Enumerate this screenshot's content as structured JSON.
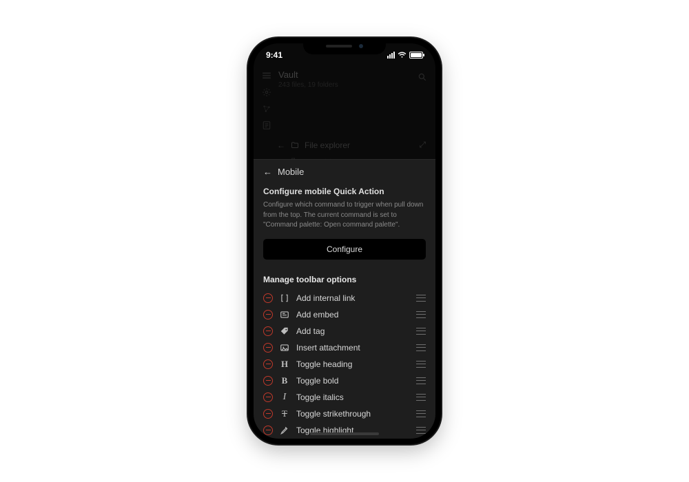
{
  "statusbar": {
    "time": "9:41"
  },
  "background": {
    "vault_title": "Vault",
    "vault_sub": "243 files, 19 folders",
    "nav_label": "File explorer"
  },
  "sheet": {
    "breadcrumb": "Mobile",
    "section_title": "Configure mobile Quick Action",
    "section_desc": "Configure which command to trigger when pull down from the top. The current command is set to \"Command palette: Open command palette\".",
    "configure_label": "Configure",
    "list_heading": "Manage toolbar options",
    "options": [
      {
        "icon": "brackets",
        "label": "Add internal link"
      },
      {
        "icon": "embed",
        "label": "Add embed"
      },
      {
        "icon": "tag",
        "label": "Add tag"
      },
      {
        "icon": "image",
        "label": "Insert attachment"
      },
      {
        "icon": "heading",
        "label": "Toggle heading"
      },
      {
        "icon": "bold",
        "label": "Toggle bold"
      },
      {
        "icon": "italic",
        "label": "Toggle italics"
      },
      {
        "icon": "strike",
        "label": "Toggle strikethrough"
      },
      {
        "icon": "highlight",
        "label": "Toggle highlight"
      }
    ]
  }
}
